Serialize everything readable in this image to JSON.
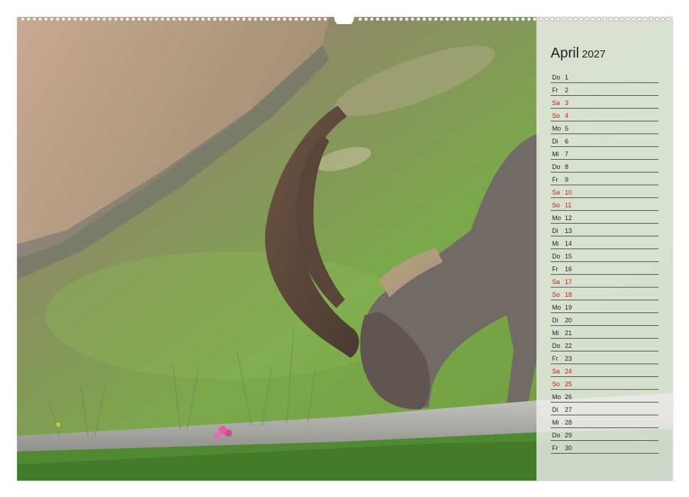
{
  "calendar": {
    "month": "April",
    "year": "2027",
    "days": [
      {
        "wd": "Do",
        "d": "1",
        "we": false
      },
      {
        "wd": "Fr",
        "d": "2",
        "we": false
      },
      {
        "wd": "Sa",
        "d": "3",
        "we": true
      },
      {
        "wd": "So",
        "d": "4",
        "we": true
      },
      {
        "wd": "Mo",
        "d": "5",
        "we": false
      },
      {
        "wd": "Di",
        "d": "6",
        "we": false
      },
      {
        "wd": "Mi",
        "d": "7",
        "we": false
      },
      {
        "wd": "Do",
        "d": "8",
        "we": false
      },
      {
        "wd": "Fr",
        "d": "9",
        "we": false
      },
      {
        "wd": "Sa",
        "d": "10",
        "we": true
      },
      {
        "wd": "So",
        "d": "11",
        "we": true
      },
      {
        "wd": "Mo",
        "d": "12",
        "we": false
      },
      {
        "wd": "Di",
        "d": "13",
        "we": false
      },
      {
        "wd": "Mi",
        "d": "14",
        "we": false
      },
      {
        "wd": "Do",
        "d": "15",
        "we": false
      },
      {
        "wd": "Fr",
        "d": "16",
        "we": false
      },
      {
        "wd": "Sa",
        "d": "17",
        "we": true
      },
      {
        "wd": "So",
        "d": "18",
        "we": true
      },
      {
        "wd": "Mo",
        "d": "19",
        "we": false
      },
      {
        "wd": "Di",
        "d": "20",
        "we": false
      },
      {
        "wd": "Mi",
        "d": "21",
        "we": false
      },
      {
        "wd": "Do",
        "d": "22",
        "we": false
      },
      {
        "wd": "Fr",
        "d": "23",
        "we": false
      },
      {
        "wd": "Sa",
        "d": "24",
        "we": true
      },
      {
        "wd": "So",
        "d": "25",
        "we": true
      },
      {
        "wd": "Mo",
        "d": "26",
        "we": false
      },
      {
        "wd": "Di",
        "d": "27",
        "we": false
      },
      {
        "wd": "Mi",
        "d": "28",
        "we": false
      },
      {
        "wd": "Do",
        "d": "29",
        "we": false
      },
      {
        "wd": "Fr",
        "d": "30",
        "we": false
      }
    ]
  },
  "colors": {
    "weekend_text": "#c21a1a",
    "weekday_text": "#222222",
    "panel_bg": "#f0f0f0"
  }
}
